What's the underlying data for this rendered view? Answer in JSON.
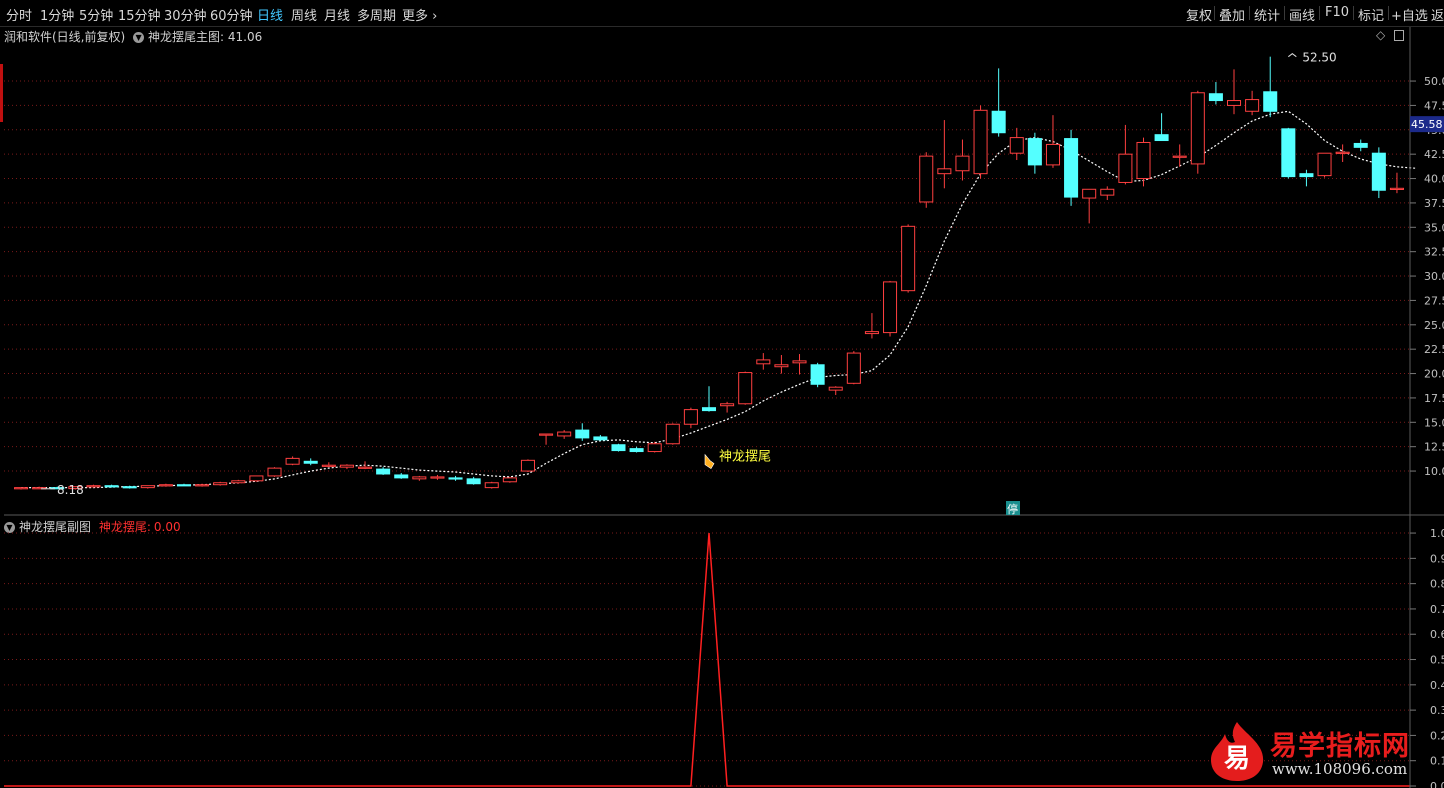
{
  "toolbar": {
    "periods": [
      "分时",
      "1分钟",
      "5分钟",
      "15分钟",
      "30分钟",
      "60分钟",
      "日线",
      "周线",
      "月线",
      "多周期",
      "更多"
    ],
    "active_period": "日线",
    "right_buttons": [
      "复权",
      "叠加",
      "统计",
      "画线",
      "F10",
      "标记",
      "+自选",
      "返"
    ]
  },
  "main_panel": {
    "title_left": "润和软件(日线,前复权)",
    "indicator_name": "神龙摆尾主图",
    "indicator_value": ": 41.06",
    "current_price_tag": "45.58",
    "high_label": "52.50",
    "low_label": "8.18",
    "signal_label": "神龙摆尾",
    "halt_marker": "停"
  },
  "sub_panel": {
    "title": "神龙摆尾副图",
    "series_label": "神龙摆尾:",
    "series_value": "0.00"
  },
  "watermark": {
    "logo_char": "易",
    "brand": "易学指标网",
    "url": "www.108096.com"
  },
  "colors": {
    "up": "#ff4040",
    "down": "#54ffff",
    "ma": "#ffffff",
    "grid": "#7a1a1a",
    "axis_text": "#c0c0c0",
    "price_tag_bg": "#1c2a8a",
    "signal": "#ff2020",
    "accent": "#42c8ff"
  },
  "chart_data": [
    {
      "type": "candlestick",
      "y_ticks": [
        "50.0",
        "47.5",
        "45.0",
        "42.5",
        "40.0",
        "37.5",
        "35.0",
        "32.5",
        "30.0",
        "27.5",
        "25.0",
        "22.5",
        "20.0",
        "17.5",
        "15.0",
        "12.5",
        "10.0"
      ],
      "ylim": [
        5.8,
        53.8
      ],
      "candles": [
        {
          "o": 8.2,
          "h": 8.3,
          "l": 8.1,
          "c": 8.3
        },
        {
          "o": 8.3,
          "h": 8.4,
          "l": 8.2,
          "c": 8.3
        },
        {
          "o": 8.3,
          "h": 8.4,
          "l": 8.2,
          "c": 8.2
        },
        {
          "o": 8.2,
          "h": 8.4,
          "l": 8.1,
          "c": 8.4
        },
        {
          "o": 8.4,
          "h": 8.6,
          "l": 8.3,
          "c": 8.5
        },
        {
          "o": 8.5,
          "h": 8.6,
          "l": 8.3,
          "c": 8.4
        },
        {
          "o": 8.4,
          "h": 8.5,
          "l": 8.2,
          "c": 8.3
        },
        {
          "o": 8.3,
          "h": 8.5,
          "l": 8.2,
          "c": 8.5
        },
        {
          "o": 8.5,
          "h": 8.7,
          "l": 8.4,
          "c": 8.6
        },
        {
          "o": 8.6,
          "h": 8.7,
          "l": 8.5,
          "c": 8.5
        },
        {
          "o": 8.5,
          "h": 8.7,
          "l": 8.4,
          "c": 8.6
        },
        {
          "o": 8.6,
          "h": 8.9,
          "l": 8.5,
          "c": 8.8
        },
        {
          "o": 8.8,
          "h": 9.1,
          "l": 8.7,
          "c": 9.0
        },
        {
          "o": 9.0,
          "h": 9.5,
          "l": 8.9,
          "c": 9.5
        },
        {
          "o": 9.5,
          "h": 10.4,
          "l": 9.4,
          "c": 10.3
        },
        {
          "o": 10.7,
          "h": 11.5,
          "l": 10.6,
          "c": 11.3
        },
        {
          "o": 11.0,
          "h": 11.3,
          "l": 10.6,
          "c": 10.8
        },
        {
          "o": 10.6,
          "h": 10.9,
          "l": 10.4,
          "c": 10.6
        },
        {
          "o": 10.4,
          "h": 10.7,
          "l": 10.2,
          "c": 10.6
        },
        {
          "o": 10.4,
          "h": 11.0,
          "l": 10.2,
          "c": 10.4
        },
        {
          "o": 10.2,
          "h": 10.4,
          "l": 9.6,
          "c": 9.7
        },
        {
          "o": 9.6,
          "h": 9.8,
          "l": 9.2,
          "c": 9.3
        },
        {
          "o": 9.2,
          "h": 9.5,
          "l": 9.0,
          "c": 9.4
        },
        {
          "o": 9.3,
          "h": 9.6,
          "l": 9.1,
          "c": 9.4
        },
        {
          "o": 9.3,
          "h": 9.5,
          "l": 9.0,
          "c": 9.2
        },
        {
          "o": 9.2,
          "h": 9.4,
          "l": 8.6,
          "c": 8.7
        },
        {
          "o": 8.3,
          "h": 8.9,
          "l": 8.2,
          "c": 8.8
        },
        {
          "o": 8.9,
          "h": 9.4,
          "l": 8.8,
          "c": 9.3
        },
        {
          "o": 10.0,
          "h": 11.2,
          "l": 9.9,
          "c": 11.1
        },
        {
          "o": 13.8,
          "h": 13.8,
          "l": 12.7,
          "c": 13.8
        },
        {
          "o": 13.6,
          "h": 14.2,
          "l": 13.3,
          "c": 14.0
        },
        {
          "o": 14.2,
          "h": 14.9,
          "l": 13.1,
          "c": 13.4
        },
        {
          "o": 13.5,
          "h": 13.7,
          "l": 13.1,
          "c": 13.2
        },
        {
          "o": 12.7,
          "h": 12.8,
          "l": 12.0,
          "c": 12.1
        },
        {
          "o": 12.3,
          "h": 12.5,
          "l": 11.9,
          "c": 12.0
        },
        {
          "o": 12.0,
          "h": 13.0,
          "l": 11.9,
          "c": 12.8
        },
        {
          "o": 12.8,
          "h": 14.9,
          "l": 12.7,
          "c": 14.8
        },
        {
          "o": 14.8,
          "h": 16.5,
          "l": 14.4,
          "c": 16.3
        },
        {
          "o": 16.5,
          "h": 18.7,
          "l": 16.1,
          "c": 16.2
        },
        {
          "o": 16.7,
          "h": 17.1,
          "l": 16.0,
          "c": 16.9
        },
        {
          "o": 16.9,
          "h": 20.2,
          "l": 16.8,
          "c": 20.1
        },
        {
          "o": 21.0,
          "h": 22.1,
          "l": 20.4,
          "c": 21.4
        },
        {
          "o": 20.7,
          "h": 21.9,
          "l": 20.0,
          "c": 20.9
        },
        {
          "o": 21.1,
          "h": 22.0,
          "l": 19.9,
          "c": 21.3
        },
        {
          "o": 20.9,
          "h": 21.1,
          "l": 18.6,
          "c": 18.9
        },
        {
          "o": 18.3,
          "h": 18.7,
          "l": 17.8,
          "c": 18.6
        },
        {
          "o": 19.0,
          "h": 22.3,
          "l": 18.9,
          "c": 22.1
        },
        {
          "o": 24.1,
          "h": 26.2,
          "l": 23.6,
          "c": 24.3
        },
        {
          "o": 24.2,
          "h": 29.5,
          "l": 23.8,
          "c": 29.4
        },
        {
          "o": 28.5,
          "h": 35.3,
          "l": 28.3,
          "c": 35.1
        },
        {
          "o": 37.6,
          "h": 42.7,
          "l": 37.0,
          "c": 42.3
        },
        {
          "o": 40.5,
          "h": 46.0,
          "l": 39.0,
          "c": 41.0
        },
        {
          "o": 40.8,
          "h": 44.0,
          "l": 39.8,
          "c": 42.3
        },
        {
          "o": 40.5,
          "h": 47.5,
          "l": 40.0,
          "c": 47.0
        },
        {
          "o": 46.9,
          "h": 51.3,
          "l": 44.3,
          "c": 44.7
        },
        {
          "o": 42.6,
          "h": 45.2,
          "l": 41.9,
          "c": 44.2
        },
        {
          "o": 44.1,
          "h": 44.7,
          "l": 40.5,
          "c": 41.4
        },
        {
          "o": 41.4,
          "h": 46.5,
          "l": 41.1,
          "c": 43.5
        },
        {
          "o": 44.1,
          "h": 45.0,
          "l": 37.2,
          "c": 38.1
        },
        {
          "o": 38.0,
          "h": 38.5,
          "l": 35.4,
          "c": 38.9
        },
        {
          "o": 38.3,
          "h": 39.2,
          "l": 37.8,
          "c": 38.9
        },
        {
          "o": 39.6,
          "h": 45.5,
          "l": 39.4,
          "c": 42.5
        },
        {
          "o": 40.0,
          "h": 44.2,
          "l": 39.2,
          "c": 43.7
        },
        {
          "o": 44.5,
          "h": 46.7,
          "l": 44.1,
          "c": 43.9
        },
        {
          "o": 42.2,
          "h": 43.5,
          "l": 41.2,
          "c": 42.3
        },
        {
          "o": 41.5,
          "h": 49.0,
          "l": 40.5,
          "c": 48.8
        },
        {
          "o": 48.7,
          "h": 49.9,
          "l": 47.6,
          "c": 48.0
        },
        {
          "o": 47.5,
          "h": 51.2,
          "l": 46.6,
          "c": 48.0
        },
        {
          "o": 46.9,
          "h": 49.0,
          "l": 46.5,
          "c": 48.1
        },
        {
          "o": 48.9,
          "h": 52.5,
          "l": 46.3,
          "c": 46.9
        },
        {
          "o": 45.1,
          "h": 45.2,
          "l": 40.0,
          "c": 40.2
        },
        {
          "o": 40.5,
          "h": 40.9,
          "l": 39.2,
          "c": 40.2
        },
        {
          "o": 40.3,
          "h": 42.1,
          "l": 40.1,
          "c": 42.6
        },
        {
          "o": 42.6,
          "h": 43.5,
          "l": 41.7,
          "c": 42.7
        },
        {
          "o": 43.6,
          "h": 44.0,
          "l": 42.8,
          "c": 43.2
        },
        {
          "o": 42.6,
          "h": 43.2,
          "l": 38.0,
          "c": 38.8
        },
        {
          "o": 39.0,
          "h": 40.6,
          "l": 38.5,
          "c": 39.0
        }
      ],
      "ma_line": [
        8.3,
        8.3,
        8.3,
        8.3,
        8.3,
        8.35,
        8.4,
        8.45,
        8.5,
        8.55,
        8.6,
        8.7,
        8.8,
        8.95,
        9.2,
        9.6,
        10.0,
        10.3,
        10.5,
        10.6,
        10.5,
        10.3,
        10.1,
        10.0,
        9.9,
        9.7,
        9.5,
        9.4,
        9.7,
        10.8,
        11.8,
        12.7,
        13.1,
        13.2,
        13.0,
        12.9,
        13.3,
        13.9,
        14.6,
        15.3,
        16.1,
        17.2,
        18.1,
        18.9,
        19.6,
        19.8,
        19.9,
        20.3,
        21.9,
        24.8,
        29.0,
        33.6,
        37.4,
        40.5,
        42.6,
        43.9,
        44.2,
        43.8,
        42.9,
        41.8,
        40.7,
        39.7,
        39.8,
        40.4,
        41.3,
        42.2,
        43.4,
        44.7,
        45.9,
        46.6,
        46.9,
        45.6,
        43.9,
        42.8,
        42.0,
        41.5,
        41.2,
        41.06
      ]
    },
    {
      "type": "line",
      "y_ticks": [
        "1.0",
        "0.9",
        "0.8",
        "0.7",
        "0.6",
        "0.5",
        "0.4",
        "0.3",
        "0.2",
        "0.1",
        "0.0"
      ],
      "ylim": [
        0,
        1.02
      ],
      "series": [
        {
          "name": "神龙摆尾",
          "spike_index": 38,
          "spike_value": 1.0,
          "baseline": 0.0
        }
      ]
    }
  ]
}
